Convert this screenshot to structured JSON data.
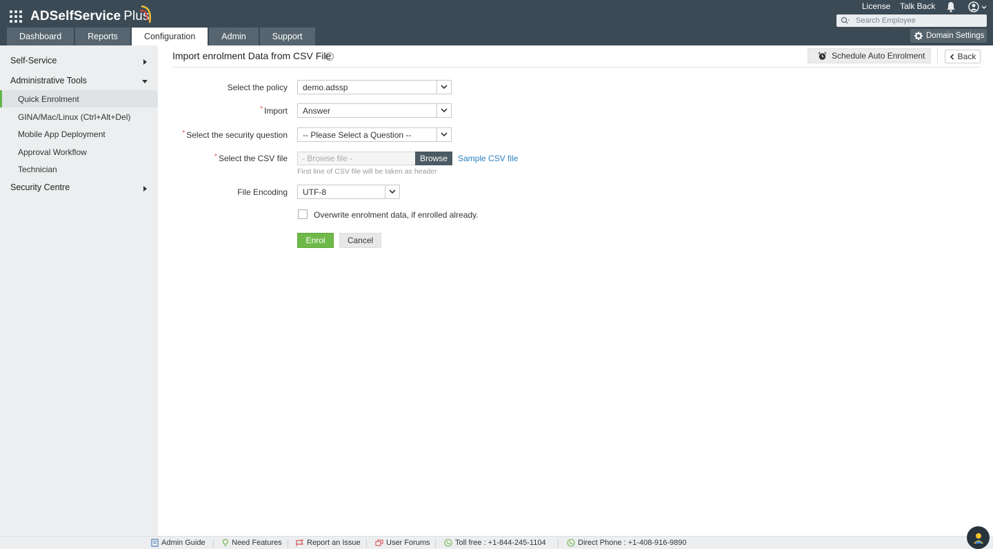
{
  "app": {
    "name_main": "ADSelfService",
    "name_suffix": "Plus"
  },
  "header": {
    "links": {
      "license": "License",
      "talk_back": "Talk Back"
    },
    "search_placeholder": "Search Employee",
    "domain_settings": "Domain Settings"
  },
  "tabs": [
    {
      "label": "Dashboard",
      "active": false
    },
    {
      "label": "Reports",
      "active": false
    },
    {
      "label": "Configuration",
      "active": true
    },
    {
      "label": "Admin",
      "active": false
    },
    {
      "label": "Support",
      "active": false
    }
  ],
  "sidebar": {
    "self_service": "Self-Service",
    "admin_tools": "Administrative Tools",
    "items": [
      {
        "label": "Quick Enrolment",
        "active": true
      },
      {
        "label": "GINA/Mac/Linux (Ctrl+Alt+Del)",
        "active": false
      },
      {
        "label": "Mobile App Deployment",
        "active": false
      },
      {
        "label": "Approval Workflow",
        "active": false
      },
      {
        "label": "Technician",
        "active": false
      }
    ],
    "security_centre": "Security Centre"
  },
  "page": {
    "title": "Import enrolment Data from CSV File",
    "help": "?",
    "schedule_button": "Schedule Auto Enrolment",
    "back_button": "Back"
  },
  "form": {
    "policy_label": "Select the policy",
    "policy_value": "demo.adssp",
    "import_label": "Import",
    "import_value": "Answer",
    "question_label": "Select the security question",
    "question_value": "-- Please Select a Question --",
    "csv_label": "Select the CSV file",
    "csv_placeholder": "- Browse file -",
    "browse_button": "Browse",
    "sample_link": "Sample CSV file",
    "csv_hint": "First line of CSV file will be taken as header",
    "encoding_label": "File Encoding",
    "encoding_value": "UTF-8",
    "overwrite_label": "Overwrite enrolment data, if enrolled already.",
    "enrol_button": "Enrol",
    "cancel_button": "Cancel",
    "required_mark": "*"
  },
  "footer": {
    "admin_guide": "Admin Guide",
    "need_features": "Need Features",
    "report_issue": "Report an Issue",
    "user_forums": "User Forums",
    "toll_free": "Toll free : +1-844-245-1104",
    "direct_phone": "Direct Phone : +1-408-916-9890"
  },
  "colors": {
    "header_bg": "#3b4a55",
    "tab_bg": "#56656f",
    "accent_green": "#6fb94a",
    "link_blue": "#2a81c2",
    "required_red": "#e0453c",
    "logo_arc_red": "#e0453c",
    "logo_arc_yellow": "#f2c12e"
  }
}
